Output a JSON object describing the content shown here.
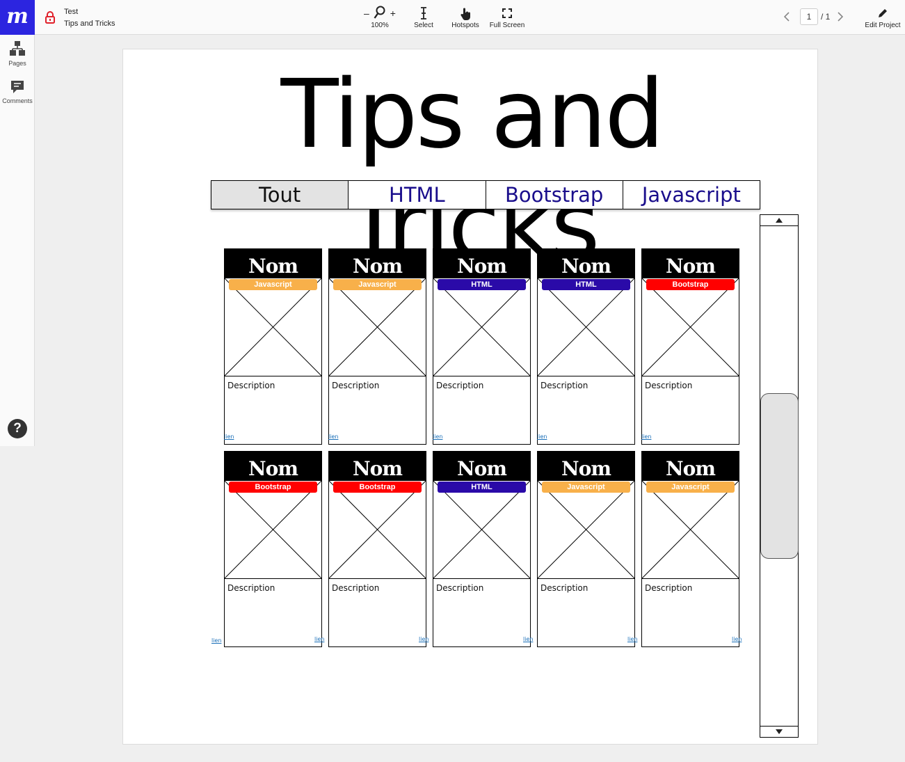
{
  "app": {
    "logo": "m"
  },
  "project": {
    "name": "Test",
    "page": "Tips and Tricks"
  },
  "toolbar": {
    "zoom_minus": "–",
    "zoom_plus": "+",
    "zoom_level": "100%",
    "select_label": "Select",
    "hotspots_label": "Hotspots",
    "fullscreen_label": "Full Screen",
    "edit_label": "Edit Project"
  },
  "pager": {
    "current": "1",
    "total": "/ 1"
  },
  "sidebar": {
    "pages_label": "Pages",
    "comments_label": "Comments",
    "help_label": "?"
  },
  "canvas": {
    "title": "Tips and Tricks",
    "tabs": [
      "Tout",
      "HTML",
      "Bootstrap",
      "Javascript"
    ],
    "colors": {
      "Javascript": "#f8b04a",
      "HTML": "#2a0aa8",
      "Bootstrap": "#ff0000"
    },
    "cards": [
      {
        "title": "Nom",
        "tag": "Javascript",
        "description": "Description",
        "link": "lien"
      },
      {
        "title": "Nom",
        "tag": "Javascript",
        "description": "Description",
        "link": "lien"
      },
      {
        "title": "Nom",
        "tag": "HTML",
        "description": "Description",
        "link": "lien"
      },
      {
        "title": "Nom",
        "tag": "HTML",
        "description": "Description",
        "link": "lien"
      },
      {
        "title": "Nom",
        "tag": "Bootstrap",
        "description": "Description",
        "link": "lien"
      },
      {
        "title": "Nom",
        "tag": "Bootstrap",
        "description": "Description",
        "link": "lien"
      },
      {
        "title": "Nom",
        "tag": "Bootstrap",
        "description": "Description",
        "link": "lien"
      },
      {
        "title": "Nom",
        "tag": "HTML",
        "description": "Description",
        "link": "lien"
      },
      {
        "title": "Nom",
        "tag": "Javascript",
        "description": "Description",
        "link": "lien"
      },
      {
        "title": "Nom",
        "tag": "Javascript",
        "description": "Description",
        "link": "lien"
      }
    ],
    "extra_link": "lien"
  }
}
